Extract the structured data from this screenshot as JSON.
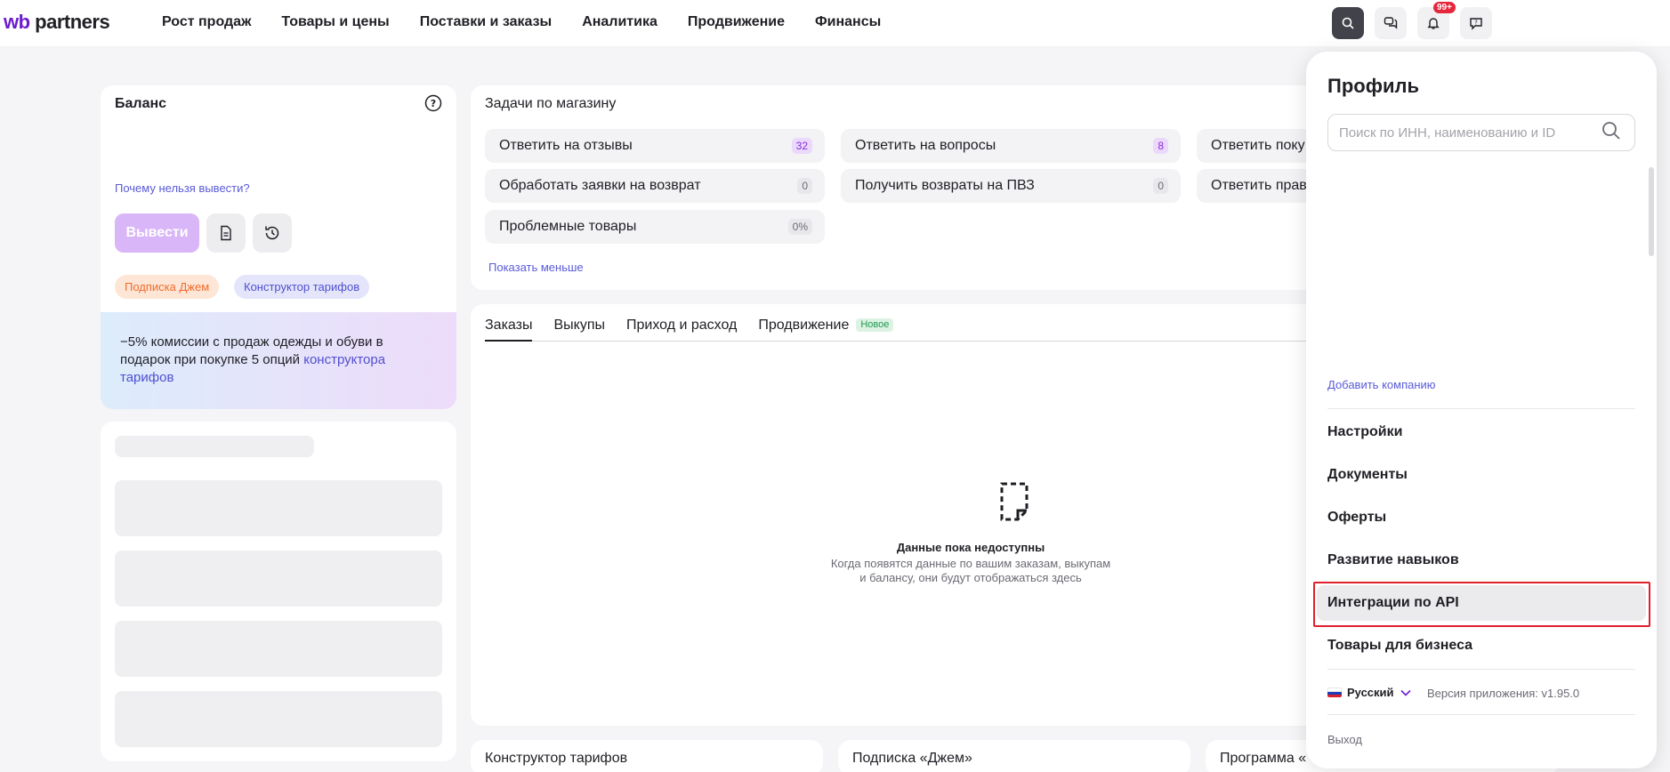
{
  "header": {
    "logo_wb": "wb",
    "logo_partners": " partners",
    "nav": [
      {
        "label": "Рост продаж"
      },
      {
        "label": "Товары и цены"
      },
      {
        "label": "Поставки и заказы"
      },
      {
        "label": "Аналитика"
      },
      {
        "label": "Продвижение"
      },
      {
        "label": "Финансы"
      }
    ],
    "notifications_badge": "99+",
    "icons": [
      "search-icon",
      "chat-icon",
      "bell-icon",
      "support-chat-icon"
    ]
  },
  "balance": {
    "title": "Баланс",
    "why_link": "Почему нельзя вывести?",
    "withdraw_label": "Вывести",
    "chips": [
      "Подписка Джем",
      "Конструктор тарифов"
    ],
    "promo_text": "−5% комиссии с продаж одежды и обуви в подарок при покупке 5 опций ",
    "promo_link": "конструктора тарифов"
  },
  "tasks": {
    "title": "Задачи по магазину",
    "items": [
      {
        "label": "Ответить на отзывы",
        "count": "32"
      },
      {
        "label": "Ответить на вопросы",
        "count": "8"
      },
      {
        "label": "Ответить поку",
        "count": ""
      },
      {
        "label": "Обработать заявки на возврат",
        "count": "0"
      },
      {
        "label": "Получить возвраты на ПВЗ",
        "count": "0"
      },
      {
        "label": "Ответить прав",
        "count": ""
      },
      {
        "label": "Проблемные товары",
        "count": "0%"
      }
    ],
    "show_less": "Показать меньше"
  },
  "orders": {
    "tabs": [
      {
        "label": "Заказы"
      },
      {
        "label": "Выкупы"
      },
      {
        "label": "Приход и расход"
      },
      {
        "label": "Продвижение"
      }
    ],
    "new_badge": "Новое",
    "empty_title": "Данные пока недоступны",
    "empty_line1": "Когда появятся данные по вашим заказам, выкупам",
    "empty_line2": "и балансу, они будут отображаться здесь"
  },
  "bottom_cards": [
    {
      "title": "Конструктор тарифов"
    },
    {
      "title": "Подписка «Джем»"
    },
    {
      "title": "Программа «"
    }
  ],
  "profile": {
    "title": "Профиль",
    "search_placeholder": "Поиск по ИНН, наименованию и ID",
    "add_company": "Добавить компанию",
    "menu": [
      {
        "label": "Настройки"
      },
      {
        "label": "Документы"
      },
      {
        "label": "Оферты"
      },
      {
        "label": "Развитие навыков"
      },
      {
        "label": "Интеграции по API"
      },
      {
        "label": "Товары для бизнеса"
      }
    ],
    "language": "Русский",
    "version": "Версия приложения: v1.95.0",
    "logout": "Выход"
  },
  "colors": {
    "accent": "#6b1ccf",
    "link": "#5a5bd8",
    "highlight_border": "#e01f2d"
  }
}
